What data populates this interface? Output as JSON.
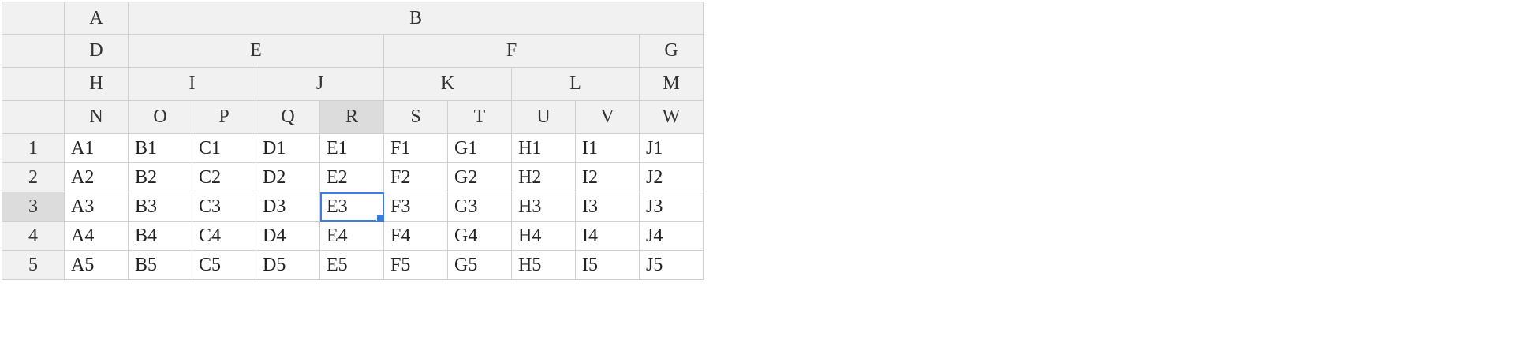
{
  "header_levels": [
    [
      {
        "label": "A",
        "span": 1
      },
      {
        "label": "B",
        "span": 9
      }
    ],
    [
      {
        "label": "D",
        "span": 1
      },
      {
        "label": "E",
        "span": 4
      },
      {
        "label": "F",
        "span": 4
      },
      {
        "label": "G",
        "span": 1
      }
    ],
    [
      {
        "label": "H",
        "span": 1
      },
      {
        "label": "I",
        "span": 2
      },
      {
        "label": "J",
        "span": 2
      },
      {
        "label": "K",
        "span": 2
      },
      {
        "label": "L",
        "span": 2
      },
      {
        "label": "M",
        "span": 1
      }
    ],
    [
      {
        "label": "N",
        "span": 1
      },
      {
        "label": "O",
        "span": 1
      },
      {
        "label": "P",
        "span": 1
      },
      {
        "label": "Q",
        "span": 1
      },
      {
        "label": "R",
        "span": 1
      },
      {
        "label": "S",
        "span": 1
      },
      {
        "label": "T",
        "span": 1
      },
      {
        "label": "U",
        "span": 1
      },
      {
        "label": "V",
        "span": 1
      },
      {
        "label": "W",
        "span": 1
      }
    ]
  ],
  "rows": [
    {
      "label": "1",
      "cells": [
        "A1",
        "B1",
        "C1",
        "D1",
        "E1",
        "F1",
        "G1",
        "H1",
        "I1",
        "J1"
      ]
    },
    {
      "label": "2",
      "cells": [
        "A2",
        "B2",
        "C2",
        "D2",
        "E2",
        "F2",
        "G2",
        "H2",
        "I2",
        "J2"
      ]
    },
    {
      "label": "3",
      "cells": [
        "A3",
        "B3",
        "C3",
        "D3",
        "E3",
        "F3",
        "G3",
        "H3",
        "I3",
        "J3"
      ]
    },
    {
      "label": "4",
      "cells": [
        "A4",
        "B4",
        "C4",
        "D4",
        "E4",
        "F4",
        "G4",
        "H4",
        "I4",
        "J4"
      ]
    },
    {
      "label": "5",
      "cells": [
        "A5",
        "B5",
        "C5",
        "D5",
        "E5",
        "F5",
        "G5",
        "H5",
        "I5",
        "J5"
      ]
    }
  ],
  "selection": {
    "row": 3,
    "column": "R",
    "cell": "E3"
  },
  "colors": {
    "selection_border": "#3b7ddd",
    "header_bg": "#f1f1f1",
    "selected_header_bg": "#dcdcdc"
  }
}
